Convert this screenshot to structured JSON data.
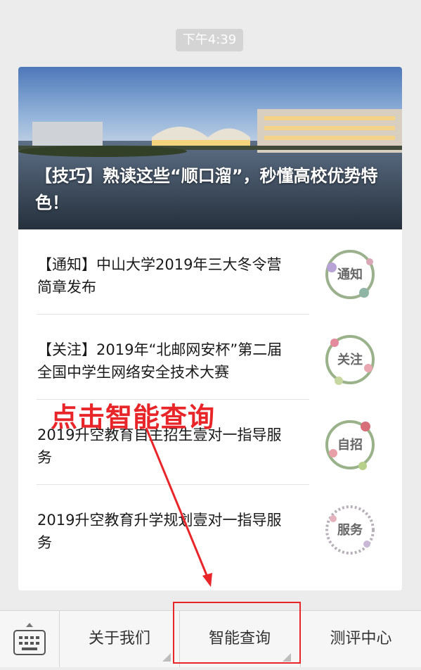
{
  "chat": {
    "timestamp": "下午4:39"
  },
  "article_card": {
    "hero_title": "【技巧】熟读这些“顺口溜”，秒懂高校优势特色！",
    "items": [
      {
        "text": "【通知】中山大学2019年三大冬令营简章发布",
        "thumb_label": "通知"
      },
      {
        "text": "【关注】2019年“北邮网安杯”第二届全国中学生网络安全技术大赛",
        "thumb_label": "关注"
      },
      {
        "text": "2019升空教育自主招生壹对一指导服务",
        "thumb_label": "自招"
      },
      {
        "text": "2019升空教育升学规划壹对一指导服务",
        "thumb_label": "服务"
      }
    ]
  },
  "annotation": {
    "text": "点击智能查询",
    "color": "#e8262a"
  },
  "menu": {
    "keyboard_icon": "keyboard-icon",
    "items": [
      {
        "label": "关于我们"
      },
      {
        "label": "智能查询"
      },
      {
        "label": "测评中心"
      }
    ]
  }
}
